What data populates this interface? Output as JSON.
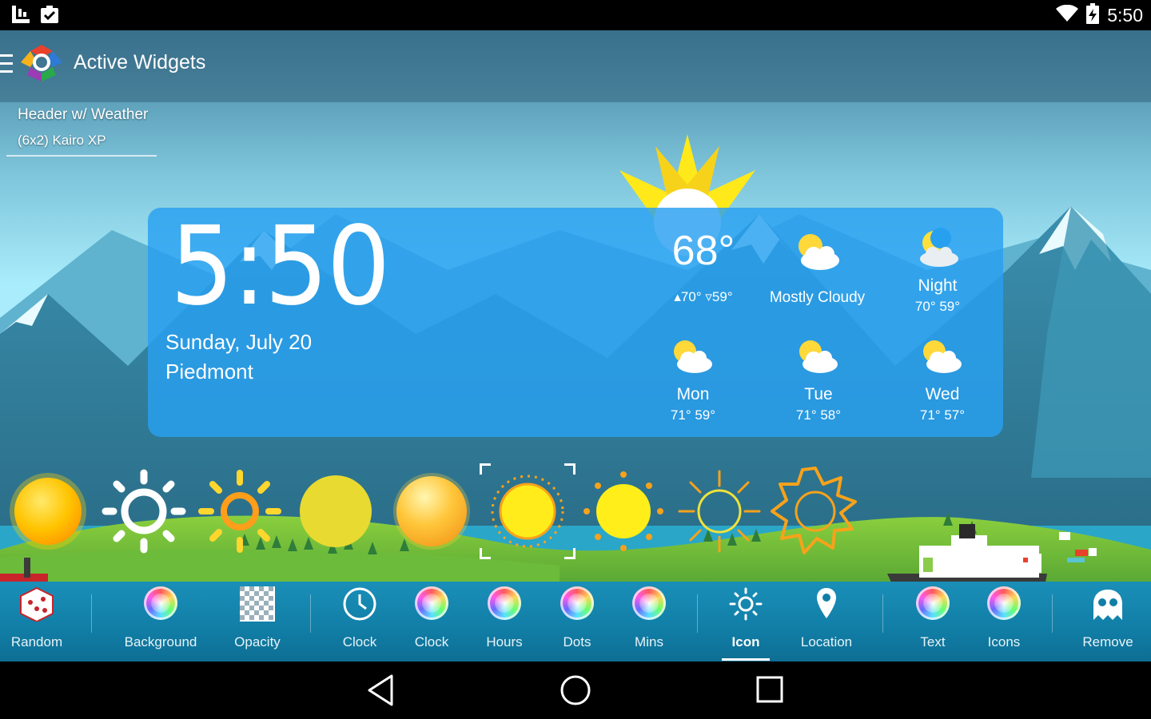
{
  "status_bar": {
    "time": "5:50",
    "icons": [
      "launcher-icon",
      "clipboard-check-icon",
      "wifi-icon",
      "battery-charging-icon"
    ]
  },
  "app": {
    "title": "Active Widgets",
    "icon": "active-widgets-logo"
  },
  "preset": {
    "title": "Header w/ Weather",
    "subtitle": "(6x2) Kairo XP"
  },
  "widget": {
    "time": "5:50",
    "date": "Sunday, July 20",
    "location": "Piedmont",
    "current": {
      "temp": "68°",
      "high": "70°",
      "low": "59°",
      "condition": "Mostly Cloudy"
    },
    "night": {
      "label": "Night",
      "temps": "70°  59°"
    },
    "forecast": [
      {
        "day": "Mon",
        "temps": "71°  59°"
      },
      {
        "day": "Tue",
        "temps": "71°  58°"
      },
      {
        "day": "Wed",
        "temps": "71°  57°"
      }
    ]
  },
  "icon_options": {
    "count": 9,
    "selected_index": 5,
    "names": [
      "glossy-sun-icon",
      "white-sun-icon",
      "orange-ring-sun-icon",
      "flat-yellow-sun-icon",
      "glossy-orange-sun-icon",
      "yellow-ringed-sun-icon",
      "yellow-dotted-sun-icon",
      "outline-yellow-sun-icon",
      "outline-orange-sun-icon"
    ]
  },
  "toolbar": {
    "active": "Icon",
    "items": [
      {
        "label": "Random",
        "icon": "dice-icon"
      },
      {
        "label": "Background",
        "icon": "color-picker-icon"
      },
      {
        "label": "Opacity",
        "icon": "checkerboard-icon"
      },
      {
        "label": "Clock",
        "icon": "clock-icon"
      },
      {
        "label": "Clock",
        "icon": "color-picker-icon"
      },
      {
        "label": "Hours",
        "icon": "color-picker-icon"
      },
      {
        "label": "Dots",
        "icon": "color-picker-icon"
      },
      {
        "label": "Mins",
        "icon": "color-picker-icon"
      },
      {
        "label": "Icon",
        "icon": "sun-icon"
      },
      {
        "label": "Location",
        "icon": "location-pin-icon"
      },
      {
        "label": "Text",
        "icon": "color-picker-icon"
      },
      {
        "label": "Icons",
        "icon": "color-picker-icon"
      },
      {
        "label": "Remove",
        "icon": "ghost-icon"
      }
    ]
  },
  "nav": {
    "buttons": [
      "back-icon",
      "home-icon",
      "recents-icon"
    ]
  },
  "colors": {
    "widget_bg": "#28a0f0",
    "toolbar": "#117ea6",
    "sky_top": "#3f7e9c",
    "sky_bottom": "#a9ecfb"
  }
}
